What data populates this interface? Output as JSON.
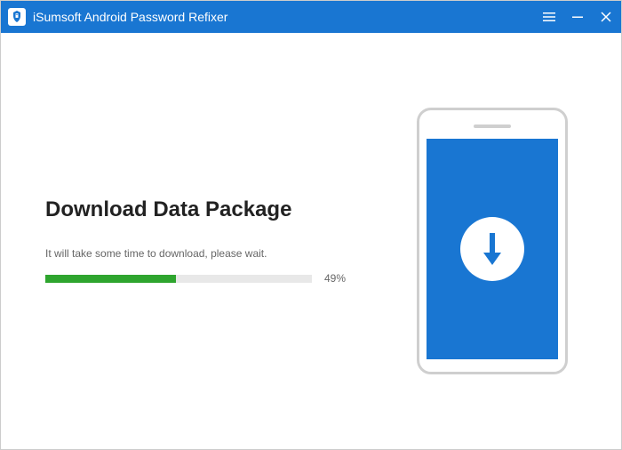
{
  "titlebar": {
    "app_name": "iSumsoft Android Password Refixer"
  },
  "main": {
    "heading": "Download Data Package",
    "subtext": "It will take some time to download, please wait.",
    "progress_percent": 49,
    "progress_label": "49%"
  },
  "colors": {
    "titlebar_bg": "#1976d2",
    "progress_fill": "#2ea52e",
    "phone_screen": "#1976d2"
  }
}
